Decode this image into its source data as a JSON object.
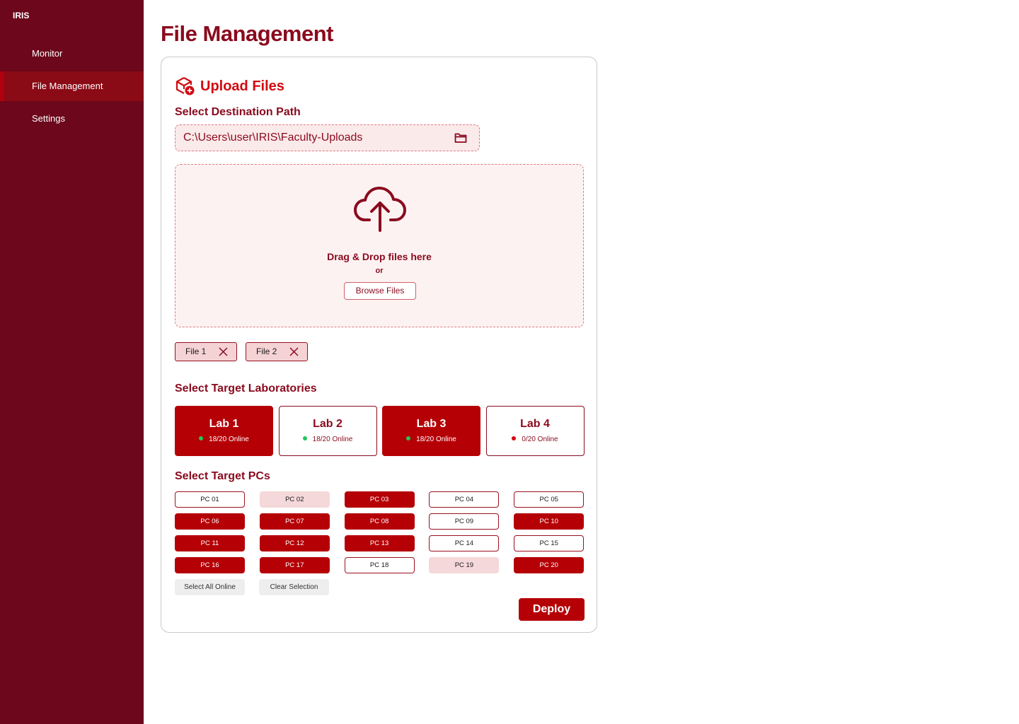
{
  "app": {
    "brand": "IRIS"
  },
  "sidebar": {
    "items": [
      {
        "label": "Monitor",
        "active": false
      },
      {
        "label": "File Management",
        "active": true
      },
      {
        "label": "Settings",
        "active": false
      }
    ]
  },
  "page": {
    "title": "File Management"
  },
  "upload": {
    "title": "Upload Files",
    "icon": "cube-upload-icon",
    "destination_label": "Select Destination Path",
    "destination_value": "C:\\Users\\user\\IRIS\\Faculty-Uploads",
    "drop_text": "Drag & Drop files here",
    "or_text": "or",
    "browse_label": "Browse Files",
    "files": [
      "File 1",
      "File 2"
    ]
  },
  "labs": {
    "label": "Select Target Laboratories",
    "items": [
      {
        "name": "Lab 1",
        "status": "18/20 Online",
        "selected": true,
        "status_color": "#22c55e"
      },
      {
        "name": "Lab 2",
        "status": "18/20 Online",
        "selected": false,
        "status_color": "#22c55e"
      },
      {
        "name": "Lab 3",
        "status": "18/20 Online",
        "selected": true,
        "status_color": "#22c55e"
      },
      {
        "name": "Lab 4",
        "status": "0/20 Online",
        "selected": false,
        "status_color": "#d20a11"
      }
    ]
  },
  "pcs": {
    "label": "Select Target PCs",
    "items": [
      {
        "name": "PC 01",
        "state": "avail"
      },
      {
        "name": "PC 02",
        "state": "off"
      },
      {
        "name": "PC 03",
        "state": "sel"
      },
      {
        "name": "PC 04",
        "state": "avail"
      },
      {
        "name": "PC 05",
        "state": "avail"
      },
      {
        "name": "PC 06",
        "state": "sel"
      },
      {
        "name": "PC 07",
        "state": "sel"
      },
      {
        "name": "PC 08",
        "state": "sel"
      },
      {
        "name": "PC 09",
        "state": "avail"
      },
      {
        "name": "PC 10",
        "state": "sel"
      },
      {
        "name": "PC 11",
        "state": "sel"
      },
      {
        "name": "PC 12",
        "state": "sel"
      },
      {
        "name": "PC 13",
        "state": "sel"
      },
      {
        "name": "PC 14",
        "state": "avail"
      },
      {
        "name": "PC 15",
        "state": "avail"
      },
      {
        "name": "PC 16",
        "state": "sel"
      },
      {
        "name": "PC 17",
        "state": "sel"
      },
      {
        "name": "PC 18",
        "state": "avail"
      },
      {
        "name": "PC 19",
        "state": "off"
      },
      {
        "name": "PC 20",
        "state": "sel"
      }
    ],
    "select_all_label": "Select All Online",
    "clear_label": "Clear Selection"
  },
  "actions": {
    "deploy_label": "Deploy"
  },
  "colors": {
    "sidebar": "#6d071b",
    "accent": "#b50006",
    "title": "#8a0a1e",
    "online": "#22c55e",
    "offline": "#d20a11"
  }
}
